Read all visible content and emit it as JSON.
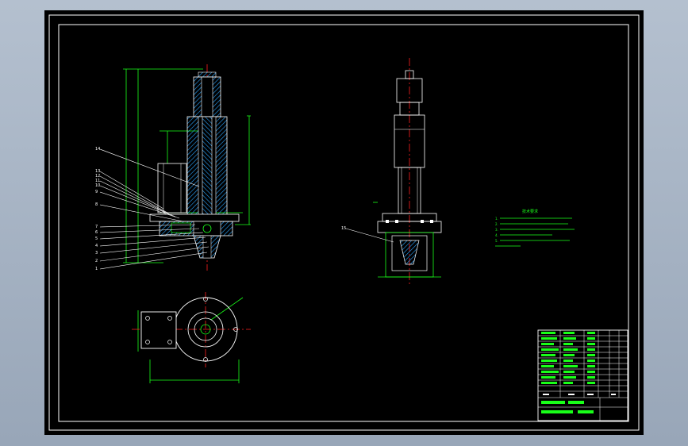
{
  "colors": {
    "background": "#000000",
    "border": "#ffffff",
    "hatch": "#2aa5ff",
    "dimension": "#19ff19",
    "centerline": "#ff2020",
    "outline": "#ffffff",
    "notes": "#19ff19"
  },
  "left_view": {
    "part_labels": [
      "14",
      "13",
      "12",
      "11",
      "10",
      "9",
      "8",
      "7",
      "6",
      "5",
      "4",
      "3",
      "2",
      "1"
    ]
  },
  "right_view": {
    "part_labels": [
      "15"
    ]
  },
  "technical_notes": {
    "title": "技术要求",
    "lines": [
      "1.",
      "2.",
      "3.",
      "4.",
      "5."
    ]
  }
}
